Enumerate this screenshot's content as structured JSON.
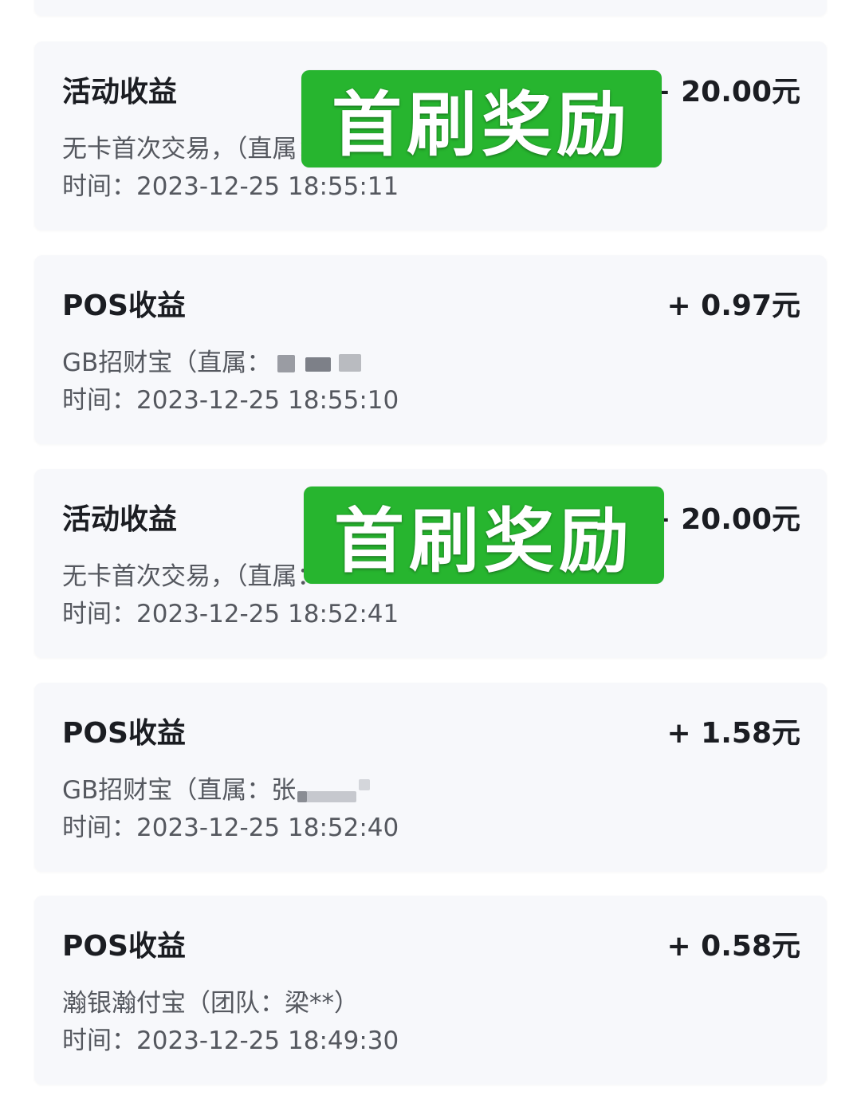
{
  "time_label": "时间：",
  "records": [
    {
      "title": "活动收益",
      "amount": "+ 20.00元",
      "description": "无卡首次交易，（直属：",
      "time": "2023-12-25 18:55:11",
      "stamp": "首刷奖励"
    },
    {
      "title": "POS收益",
      "amount": "+ 0.97元",
      "description": "GB招财宝（直属：",
      "time": "2023-12-25 18:55:10"
    },
    {
      "title": "活动收益",
      "amount": "+ 20.00元",
      "description": "无卡首次交易，（直属：",
      "time": "2023-12-25 18:52:41",
      "stamp": "首刷奖励"
    },
    {
      "title": "POS收益",
      "amount": "+ 1.58元",
      "description": "GB招财宝（直属：张",
      "time": "2023-12-25 18:52:40"
    },
    {
      "title": "POS收益",
      "amount": "+ 0.58元",
      "description": "瀚银瀚付宝（团队：梁**）",
      "time": "2023-12-25 18:49:30"
    }
  ],
  "colors": {
    "card_background": "#f7f8fb",
    "title_text": "#1b1d22",
    "secondary_text": "#55585f",
    "stamp_green": "#27b52f"
  }
}
